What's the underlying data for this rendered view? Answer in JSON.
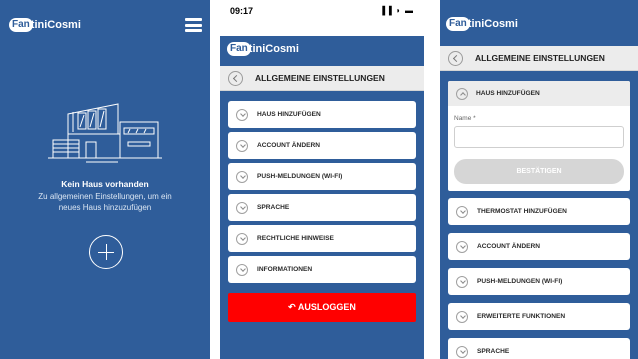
{
  "brand": {
    "badge": "Fan",
    "word_a": "tini",
    "word_b": "Cosmi"
  },
  "screen1": {
    "title": "Kein Haus vorhanden",
    "message": "Zu allgemeinen Einstellungen, um ein neues Haus hinzuzufügen"
  },
  "screen2": {
    "status_time": "09:17",
    "status_icons": "▐▐ ◗ ▬",
    "header_title": "ALLGEMEINE EINSTELLUNGEN",
    "menu": [
      {
        "label": "HAUS HINZUFÜGEN"
      },
      {
        "label": "ACCOUNT ÄNDERN"
      },
      {
        "label": "PUSH-MELDUNGEN (WI-FI)"
      },
      {
        "label": "SPRACHE"
      },
      {
        "label": "RECHTLICHE HINWEISE"
      },
      {
        "label": "INFORMATIONEN"
      }
    ],
    "logout_label": "↶ AUSLOGGEN"
  },
  "screen3": {
    "header_title": "ALLGEMEINE EINSTELLUNGEN",
    "expanded": {
      "label": "HAUS HINZUFÜGEN",
      "name_label": "Name *",
      "name_value": "",
      "confirm_label": "BESTÄTIGEN"
    },
    "menu": [
      {
        "label": "THERMOSTAT HINZUFÜGEN"
      },
      {
        "label": "ACCOUNT ÄNDERN"
      },
      {
        "label": "PUSH-MELDUNGEN (WI-FI)"
      },
      {
        "label": "ERWEITERTE FUNKTIONEN"
      },
      {
        "label": "SPRACHE"
      }
    ]
  },
  "colors": {
    "primary": "#2f5d9a",
    "logout": "#ff0000",
    "disabled": "#d6d6d6"
  }
}
